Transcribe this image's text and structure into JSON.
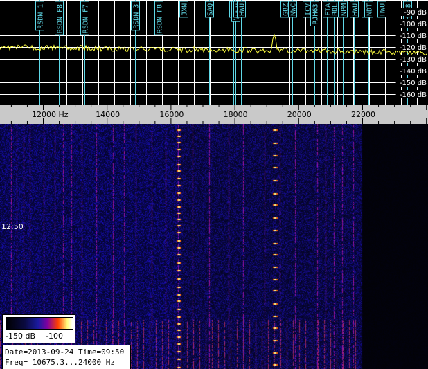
{
  "window": {
    "title": ""
  },
  "spectrum": {
    "db_labels": [
      "-90 dB",
      "-100 dB",
      "-110 dB",
      "-120 dB",
      "-130 dB",
      "-140 dB",
      "-150 dB",
      "-160 dB"
    ],
    "station_markers": [
      {
        "label": "RSDN_1",
        "freq": 11900
      },
      {
        "label": "RSDN_F8",
        "freq": 12500
      },
      {
        "label": "RSDN_F7",
        "freq": 13300
      },
      {
        "label": "RSDN_3",
        "freq": 14880
      },
      {
        "label": "RSDN_F8",
        "freq": 15620
      },
      {
        "label": "JXN",
        "freq": 16400
      },
      {
        "label": "SAQ",
        "freq": 17200
      },
      {
        "label": "NAA",
        "freq": 17960
      },
      {
        "label": "VTX3",
        "freq": 18040
      },
      {
        "label": "HWU",
        "freq": 18100
      },
      {
        "label": "HWU",
        "freq": 18200
      },
      {
        "label": "GBZ",
        "freq": 19580
      },
      {
        "label": "NWC",
        "freq": 19800
      },
      {
        "label": "ICV",
        "freq": 20270
      },
      {
        "label": "RJH63",
        "freq": 20500
      },
      {
        "label": "FTA",
        "freq": 20900
      },
      {
        "label": "RDL",
        "freq": 21100
      },
      {
        "label": "NPM",
        "freq": 21400
      },
      {
        "label": "HWU",
        "freq": 21750
      },
      {
        "label": "NML",
        "freq": 22100
      },
      {
        "label": "NDT",
        "freq": 22200
      },
      {
        "label": "HWU",
        "freq": 22600
      },
      {
        "label": "DHO38",
        "freq": 23400
      }
    ]
  },
  "frequency_scale": {
    "ticks": [
      {
        "label": "12000 Hz",
        "freq": 12000
      },
      {
        "label": "14000",
        "freq": 14000
      },
      {
        "label": "16000",
        "freq": 16000
      },
      {
        "label": "18000",
        "freq": 18000
      },
      {
        "label": "20000",
        "freq": 20000
      },
      {
        "label": "22000",
        "freq": 22000
      }
    ]
  },
  "waterfall": {
    "time_marker": "12:50"
  },
  "legend": {
    "min_label": "-150 dB",
    "max_label": "-100"
  },
  "info": {
    "date_time": "Date=2013-09-24 Time=09:50",
    "freq_range": "Freq= 10675.3...24000 Hz"
  },
  "colors": {
    "grid": "#ffffff",
    "marker": "#5fd7e6",
    "trace": "#ffff40",
    "waterfall_bg": "#06063a"
  }
}
